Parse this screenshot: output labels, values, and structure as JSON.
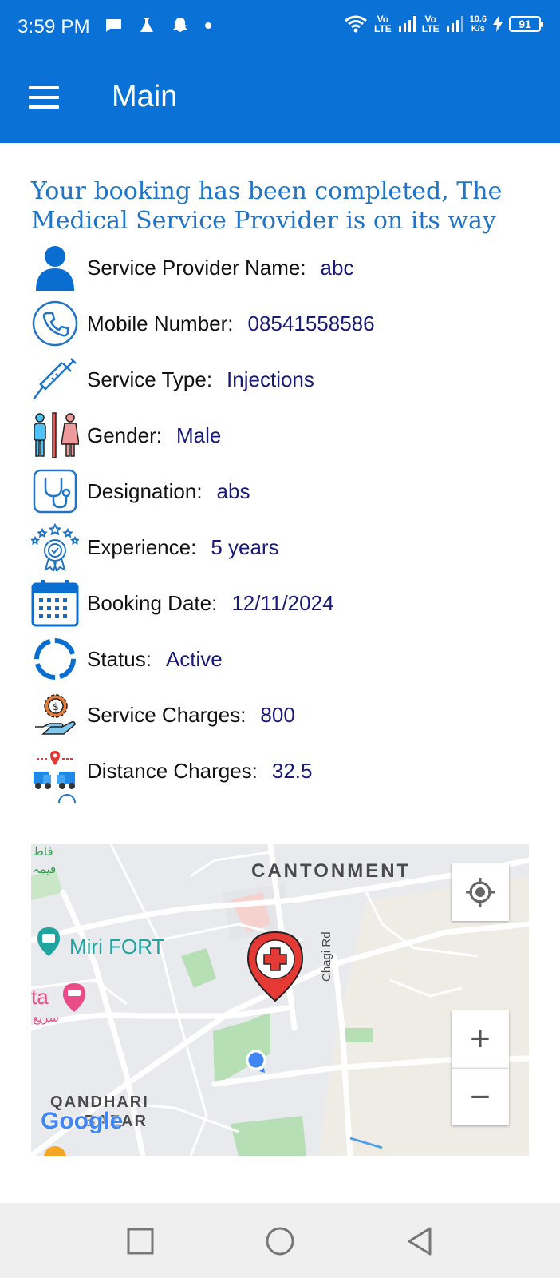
{
  "status_bar": {
    "time": "3:59 PM",
    "lte1": "Vo\nLTE",
    "lte2": "Vo\nLTE",
    "net_speed_value": "10.6",
    "net_speed_unit": "K/s",
    "battery": "91"
  },
  "app_bar": {
    "title": "Main"
  },
  "booking": {
    "headline": "Your booking has been completed, The Medical Service Provider is on its way",
    "rows": [
      {
        "label": "Service Provider Name:",
        "value": "abc",
        "icon": "person-icon"
      },
      {
        "label": "Mobile Number:",
        "value": "08541558586",
        "icon": "phone-icon"
      },
      {
        "label": "Service Type:",
        "value": "Injections",
        "icon": "syringe-icon"
      },
      {
        "label": "Gender:",
        "value": "Male",
        "icon": "gender-icon"
      },
      {
        "label": "Designation:",
        "value": "abs",
        "icon": "stethoscope-icon"
      },
      {
        "label": "Experience:",
        "value": "5 years",
        "icon": "award-icon"
      },
      {
        "label": "Booking Date:",
        "value": "12/11/2024",
        "icon": "calendar-icon"
      },
      {
        "label": "Status:",
        "value": "Active",
        "icon": "status-ring-icon"
      },
      {
        "label": "Service Charges:",
        "value": "800",
        "icon": "service-charges-icon"
      },
      {
        "label": "Distance Charges:",
        "value": "32.5",
        "icon": "distance-truck-icon"
      }
    ]
  },
  "map": {
    "labels": {
      "cantonment": "CANTONMENT",
      "miri_fort": "Miri FORT",
      "chagi_rd": "Chagi Rd",
      "qandhari": "QANDHARI",
      "bazar": "BAZAR",
      "ta": "ta",
      "google": "Google",
      "urdu1": "فاط",
      "urdu2": "فیمہ",
      "urdu3": "سريع"
    },
    "zoom_in": "+",
    "zoom_out": "−"
  },
  "colors": {
    "primary": "#0a72d6",
    "headline": "#1f74c7",
    "value_text": "#1a1a7a",
    "marker": "#e53935"
  }
}
